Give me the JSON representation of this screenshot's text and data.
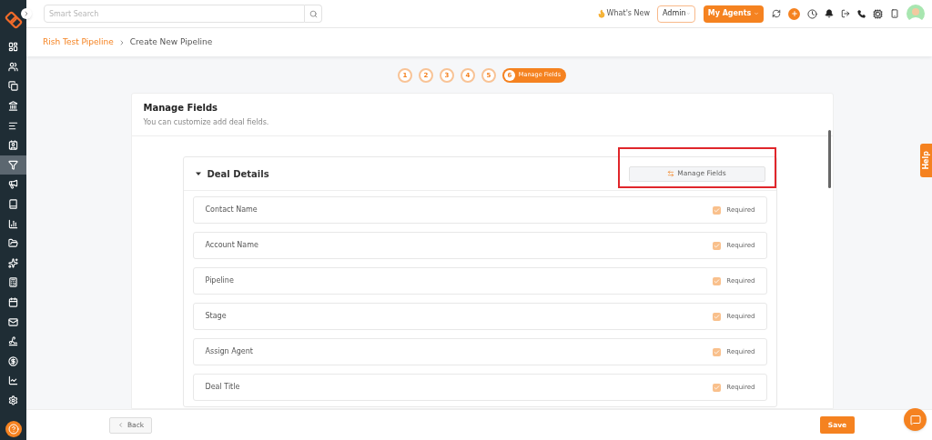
{
  "search": {
    "placeholder": "Smart Search"
  },
  "header": {
    "whats_new": "What's New",
    "role": "Admin",
    "agents_button": "My Agents"
  },
  "breadcrumb": [
    {
      "label": "Rish Test Pipeline",
      "kind": "link"
    },
    {
      "label": "Create New Pipeline",
      "kind": "current"
    }
  ],
  "sidebar": {
    "items": [
      {
        "selected": false
      },
      {
        "selected": false
      },
      {
        "selected": false
      },
      {
        "selected": false
      },
      {
        "selected": false
      },
      {
        "selected": false
      },
      {
        "selected": true
      },
      {
        "selected": false
      },
      {
        "selected": false
      },
      {
        "selected": false
      },
      {
        "selected": false
      },
      {
        "selected": false
      },
      {
        "selected": false
      },
      {
        "selected": false
      },
      {
        "selected": false
      },
      {
        "selected": false
      },
      {
        "selected": false
      },
      {
        "selected": false
      },
      {
        "selected": false
      }
    ]
  },
  "steps": [
    {
      "number": "1",
      "selected": false
    },
    {
      "number": "2",
      "selected": false
    },
    {
      "number": "3",
      "selected": false
    },
    {
      "number": "4",
      "selected": false
    },
    {
      "number": "5",
      "selected": false
    },
    {
      "number": "6",
      "label": "Manage Fields",
      "selected": true
    }
  ],
  "card": {
    "title": "Manage Fields",
    "subtitle": "You can customize add deal fields."
  },
  "section": {
    "title": "Deal Details",
    "expanded": true,
    "button": "Manage Fields",
    "fields": [
      {
        "name": "Contact Name",
        "checked": true,
        "label": "Required"
      },
      {
        "name": "Account Name",
        "checked": true,
        "label": "Required"
      },
      {
        "name": "Pipeline",
        "checked": true,
        "label": "Required"
      },
      {
        "name": "Stage",
        "checked": true,
        "label": "Required"
      },
      {
        "name": "Assign Agent",
        "checked": true,
        "label": "Required"
      },
      {
        "name": "Deal Title",
        "checked": true,
        "label": "Required"
      }
    ]
  },
  "help_tab": "Help",
  "footer": {
    "back": "Back",
    "save": "Save"
  }
}
